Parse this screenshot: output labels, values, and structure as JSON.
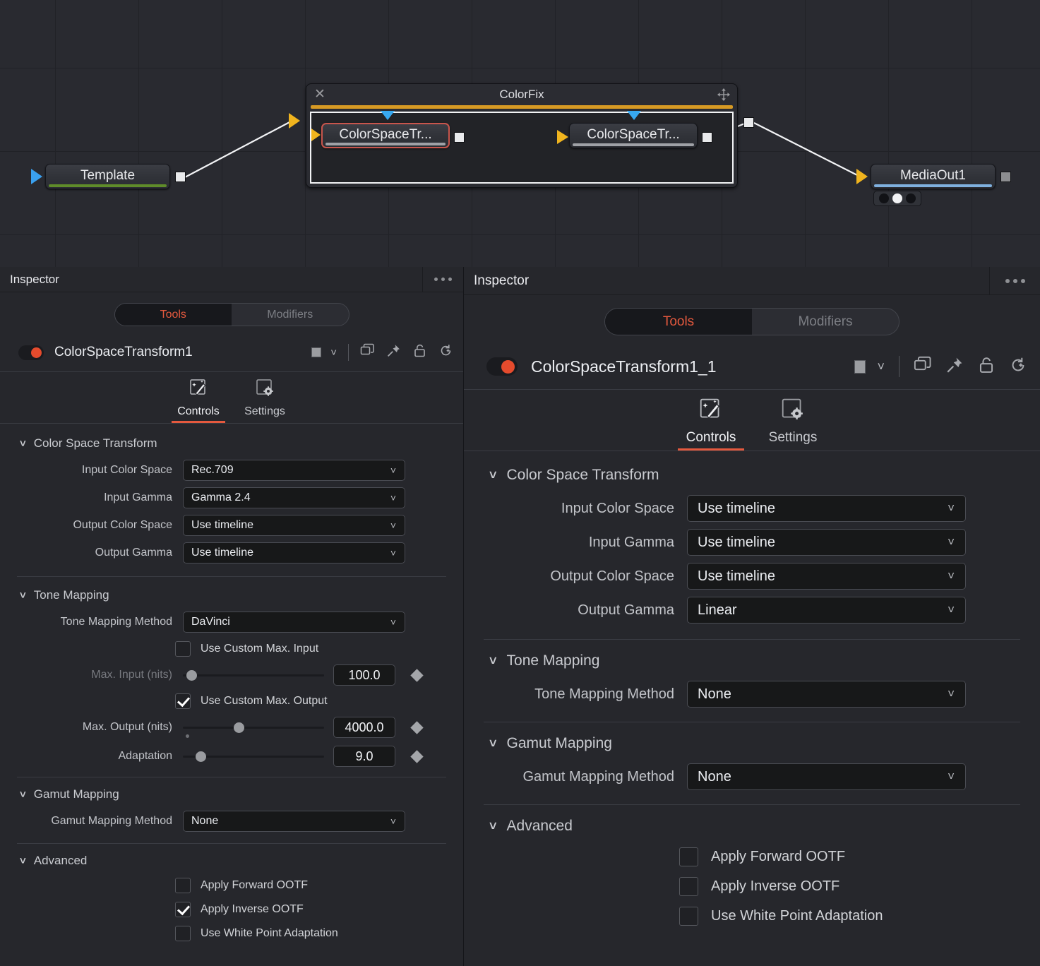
{
  "node_graph": {
    "nodes": [
      {
        "name": "Template",
        "underbar_color": "#5f8c2a"
      },
      {
        "name": "ColorSpaceTr...",
        "underbar_color": "#9fa1a6"
      },
      {
        "name": "ColorSpaceTr...",
        "underbar_color": "#9fa1a6"
      },
      {
        "name": "MediaOut1",
        "underbar_color": "#7fb0de"
      }
    ],
    "group": {
      "title": "ColorFix",
      "close_icon": "close-icon",
      "move_icon": "move-crosshair-icon",
      "accent_color": "#d79a24"
    }
  },
  "left_inspector": {
    "title": "Inspector",
    "overflow_icon": "ellipsis-icon",
    "tools_tab": "Tools",
    "modifiers_tab": "Modifiers",
    "node_name": "ColorSpaceTransform1",
    "header_icons": [
      "color-swatch-icon",
      "chevron-down-icon",
      "duplicate-icon",
      "pin-icon",
      "unlock-icon",
      "reset-version-icon"
    ],
    "tabs": [
      {
        "label": "Controls",
        "icon": "magic-wand-icon",
        "active": true
      },
      {
        "label": "Settings",
        "icon": "gear-panel-icon",
        "active": false
      }
    ],
    "sections": {
      "color_space_transform": {
        "title": "Color Space Transform",
        "params": [
          {
            "label": "Input Color Space",
            "value": "Rec.709"
          },
          {
            "label": "Input Gamma",
            "value": "Gamma 2.4"
          },
          {
            "label": "Output Color Space",
            "value": "Use timeline"
          },
          {
            "label": "Output Gamma",
            "value": "Use timeline"
          }
        ]
      },
      "tone_mapping": {
        "title": "Tone Mapping",
        "method_label": "Tone Mapping Method",
        "method_value": "DaVinci",
        "use_custom_max_input": {
          "label": "Use Custom Max. Input",
          "checked": false
        },
        "max_input": {
          "label": "Max. Input (nits)",
          "value": "100.0",
          "slider_pct": 2,
          "disabled": true
        },
        "use_custom_max_output": {
          "label": "Use Custom Max. Output",
          "checked": true
        },
        "max_output": {
          "label": "Max. Output (nits)",
          "value": "4000.0",
          "slider_pct": 40,
          "disabled": false
        },
        "adaptation": {
          "label": "Adaptation",
          "value": "9.0",
          "slider_pct": 8,
          "disabled": false
        }
      },
      "gamut_mapping": {
        "title": "Gamut Mapping",
        "method_label": "Gamut Mapping Method",
        "method_value": "None"
      },
      "advanced": {
        "title": "Advanced",
        "checkboxes": [
          {
            "label": "Apply Forward OOTF",
            "checked": false
          },
          {
            "label": "Apply Inverse OOTF",
            "checked": true
          },
          {
            "label": "Use White Point Adaptation",
            "checked": false
          }
        ]
      }
    }
  },
  "right_inspector": {
    "title": "Inspector",
    "overflow_icon": "ellipsis-icon",
    "tools_tab": "Tools",
    "modifiers_tab": "Modifiers",
    "node_name": "ColorSpaceTransform1_1",
    "header_icons": [
      "color-swatch-icon",
      "chevron-down-icon",
      "duplicate-icon",
      "pin-icon",
      "unlock-icon",
      "reset-version-icon"
    ],
    "tabs": [
      {
        "label": "Controls",
        "icon": "magic-wand-icon",
        "active": true
      },
      {
        "label": "Settings",
        "icon": "gear-panel-icon",
        "active": false
      }
    ],
    "sections": {
      "color_space_transform": {
        "title": "Color Space Transform",
        "params": [
          {
            "label": "Input Color Space",
            "value": "Use timeline"
          },
          {
            "label": "Input Gamma",
            "value": "Use timeline"
          },
          {
            "label": "Output Color Space",
            "value": "Use timeline"
          },
          {
            "label": "Output Gamma",
            "value": "Linear"
          }
        ]
      },
      "tone_mapping": {
        "title": "Tone Mapping",
        "method_label": "Tone Mapping Method",
        "method_value": "None"
      },
      "gamut_mapping": {
        "title": "Gamut Mapping",
        "method_label": "Gamut Mapping Method",
        "method_value": "None"
      },
      "advanced": {
        "title": "Advanced",
        "checkboxes": [
          {
            "label": "Apply Forward OOTF",
            "checked": false
          },
          {
            "label": "Apply Inverse OOTF",
            "checked": false
          },
          {
            "label": "Use White Point Adaptation",
            "checked": false
          }
        ]
      }
    }
  },
  "colors": {
    "accent_red": "#e4593e",
    "link_white": "#f2f3f5",
    "link_yellow": "#f0b41e",
    "panel_bg": "#26272c",
    "graph_bg": "#292a30"
  }
}
